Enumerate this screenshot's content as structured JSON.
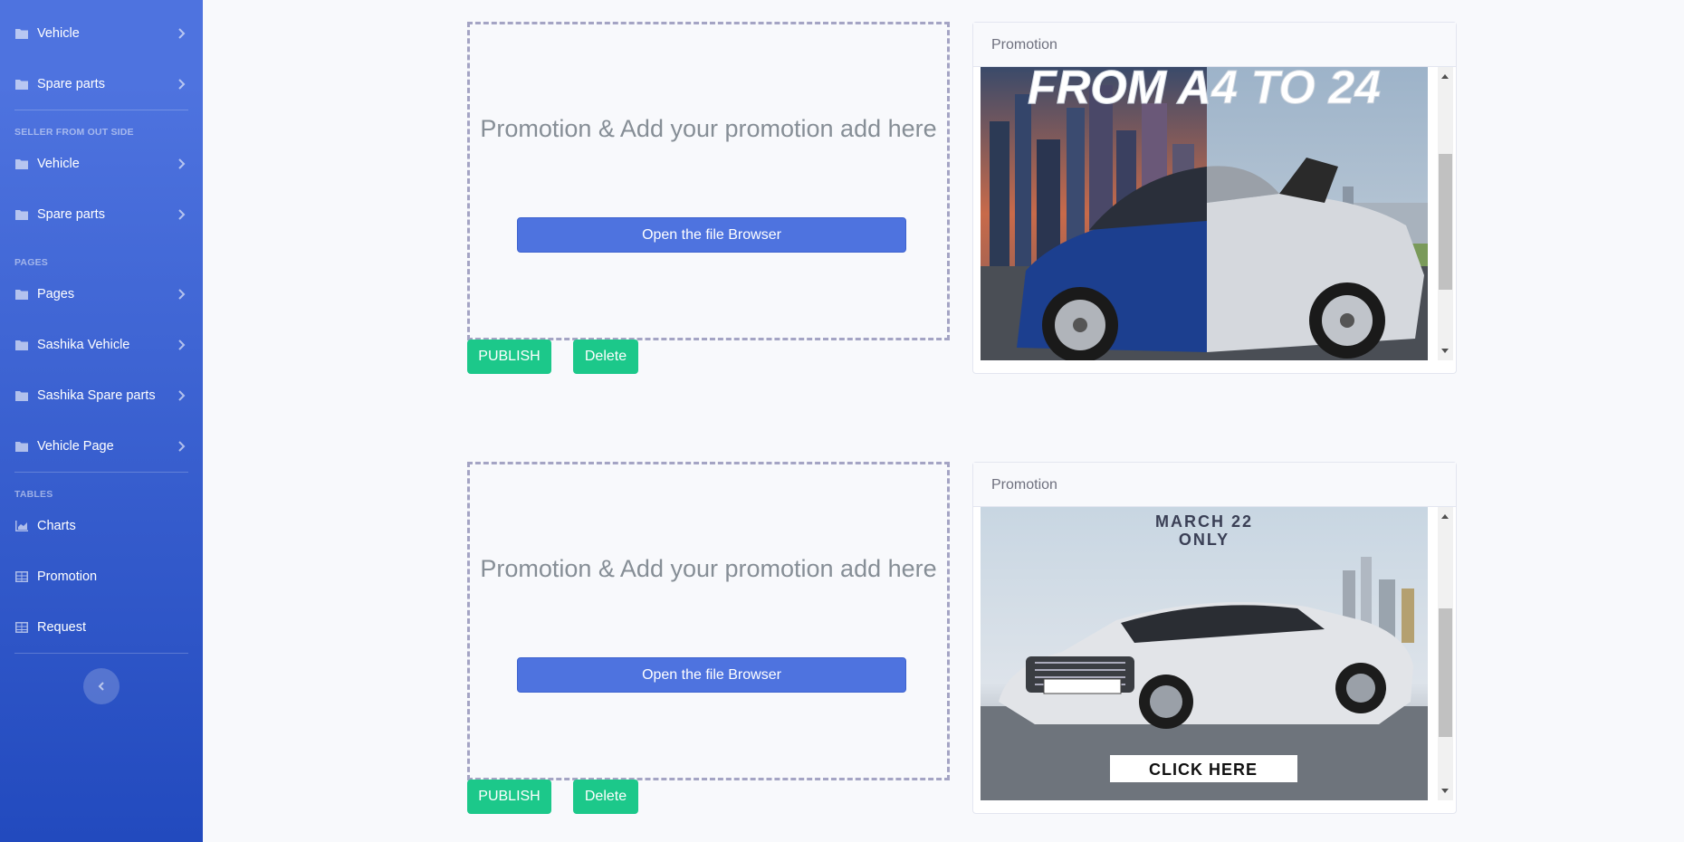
{
  "sidebar": {
    "items_top": [
      {
        "label": "Vehicle",
        "icon": "folder-icon"
      },
      {
        "label": "Spare parts",
        "icon": "folder-icon"
      }
    ],
    "heading_seller": "SELLER FROM OUT SIDE",
    "items_seller": [
      {
        "label": "Vehicle",
        "icon": "folder-icon"
      },
      {
        "label": "Spare parts",
        "icon": "folder-icon"
      }
    ],
    "heading_pages": "PAGES",
    "items_pages": [
      {
        "label": "Pages",
        "icon": "folder-icon"
      },
      {
        "label": "Sashika Vehicle",
        "icon": "folder-icon"
      },
      {
        "label": "Sashika Spare parts",
        "icon": "folder-icon"
      },
      {
        "label": "Vehicle Page",
        "icon": "folder-icon"
      }
    ],
    "heading_tables": "TABLES",
    "items_tables": [
      {
        "label": "Charts",
        "icon": "chart-area-icon"
      },
      {
        "label": "Promotion",
        "icon": "table-icon"
      },
      {
        "label": "Request",
        "icon": "table-icon"
      }
    ]
  },
  "uploads": [
    {
      "dropzone_text": "Promotion & Add your promotion add here",
      "file_button": "Open the file Browser",
      "publish": "PUBLISH",
      "delete": "Delete",
      "preview_title": "Promotion",
      "banner_text": "FROM A4 TO 24"
    },
    {
      "dropzone_text": "Promotion & Add your promotion add here",
      "file_button": "Open the file Browser",
      "publish": "PUBLISH",
      "delete": "Delete",
      "preview_title": "Promotion",
      "banner_line1": "MARCH 22",
      "banner_line2": "ONLY",
      "banner_cta": "CLICK HERE"
    }
  ],
  "colors": {
    "primary": "#4e73df",
    "success": "#1cc88a",
    "dropzone_border": "#a4a4c4"
  }
}
